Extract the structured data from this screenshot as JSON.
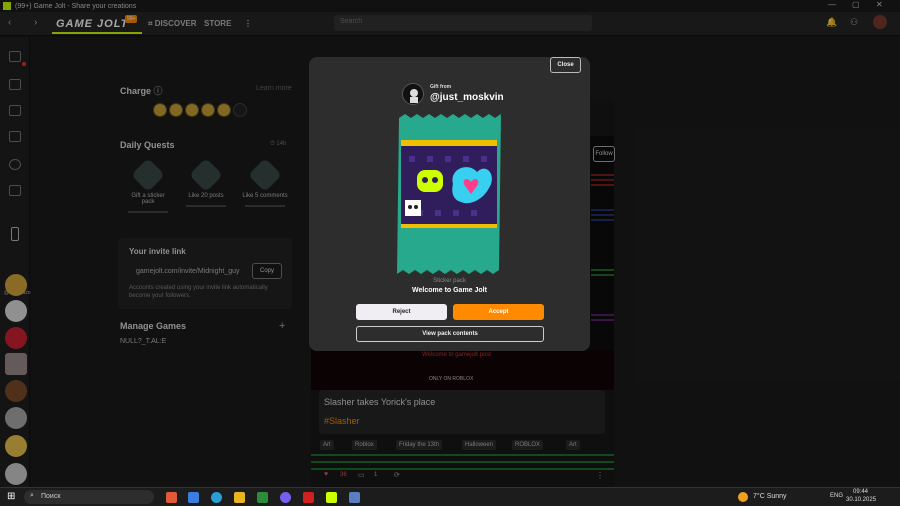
{
  "window": {
    "title": "(99+) Game Jolt - Share your creations"
  },
  "nav": {
    "logo_text": "GAME JOLT",
    "logo_badge": "99+",
    "discover": "DISCOVER",
    "store": "STORE",
    "more": "⋮",
    "search_placeholder": "Search"
  },
  "charge": {
    "title": "Charge",
    "learn_more": "Learn more",
    "count_icons": 5
  },
  "quests": {
    "title": "Daily Quests",
    "timer": "14h",
    "items": [
      {
        "label": "Gift a sticker pack"
      },
      {
        "label": "Like 20 posts"
      },
      {
        "label": "Like 5 comments"
      }
    ]
  },
  "invite": {
    "title": "Your invite link",
    "link": "gamejolt.com/invite/Midnight_guy",
    "copy": "Copy",
    "desc": "Accounts created using your invite link automatically become your followers."
  },
  "manage": {
    "title": "Manage Games",
    "add": "+",
    "game": "NULL?_T.AL:E"
  },
  "sidebar": {
    "user_label": "@shiftyrazo"
  },
  "modal": {
    "close": "Close",
    "gift_from": "Gift from",
    "username": "@just_moskvin",
    "pack_subtitle": "Sticker pack",
    "pack_title": "Welcome to Game Jolt",
    "reject": "Reject",
    "accept": "Accept",
    "view_contents": "View pack contents"
  },
  "feed": {
    "post_title": "Slasher takes Yorick's place",
    "hashtag": "#Slasher",
    "tags": [
      "Art",
      "Roblox",
      "Friday the 13th",
      "Halloween",
      "ROBLOX",
      "Art"
    ],
    "likes": "36",
    "comments": "1",
    "follow": "Follow",
    "banner_line": "Welcome to gamejolt post",
    "banner_bottom": "ONLY ON ROBLOX"
  },
  "taskbar": {
    "search": "Поиск",
    "weather": "7°C  Sunny",
    "lang": "ENG",
    "time": "09:44",
    "date": "30.10.2025"
  },
  "colors": {
    "accent": "#ccff00",
    "orange": "#ff8a00",
    "pack_teal": "#27a98e"
  }
}
